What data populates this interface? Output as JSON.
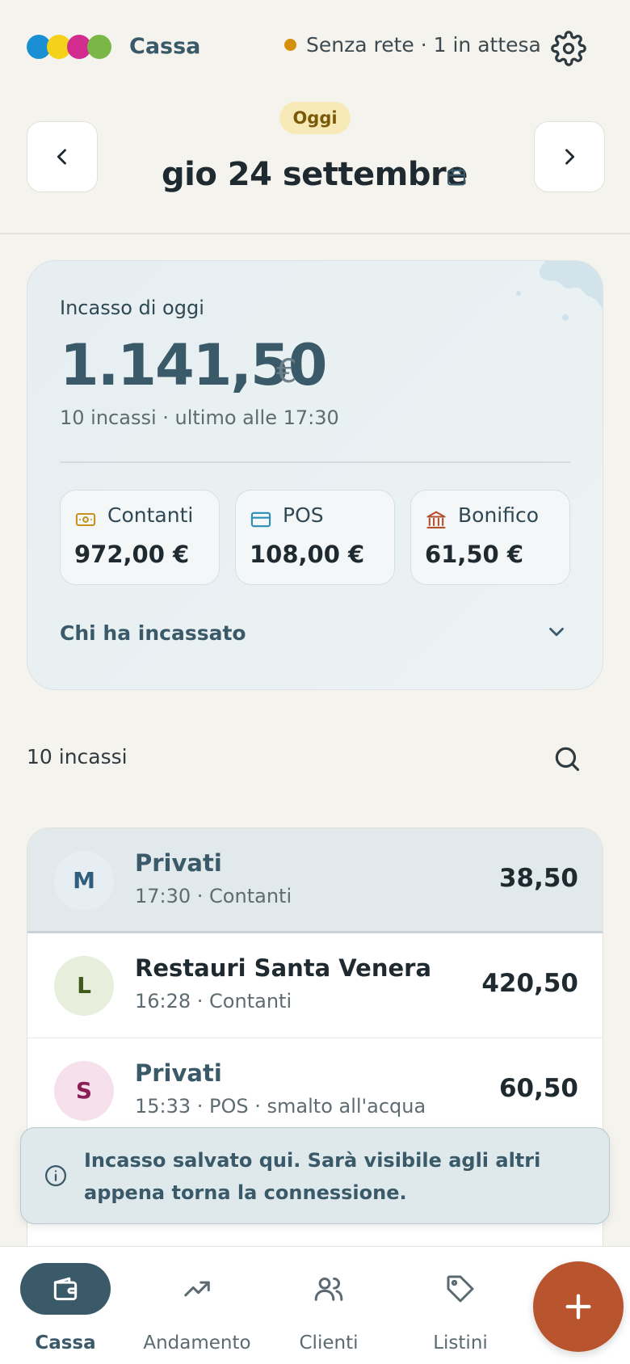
{
  "header": {
    "app_name": "Cassa",
    "logo_colors": [
      "#1b8fd4",
      "#f4d21a",
      "#d12c8e",
      "#7bb746"
    ],
    "status_text": "Senza rete · 1 in attesa",
    "status_color": "#d4900a",
    "settings_icon": "gear-icon"
  },
  "date_nav": {
    "today_badge": "Oggi",
    "date_label": "gio 24 settembre",
    "prev_icon": "chevron-left-icon",
    "next_icon": "chevron-right-icon",
    "calendar_icon": "calendar-icon"
  },
  "summary": {
    "label": "Incasso di oggi",
    "total": "1.141,50",
    "currency": "€",
    "subtitle": "10 incassi · ultimo alle 17:30",
    "methods": [
      {
        "label": "Contanti",
        "value": "972,00 €",
        "icon": "cash-icon",
        "color": "#c7921f"
      },
      {
        "label": "POS",
        "value": "108,00 €",
        "icon": "card-icon",
        "color": "#2a8db6"
      },
      {
        "label": "Bonifico",
        "value": "61,50 €",
        "icon": "bank-icon",
        "color": "#b4502d"
      }
    ],
    "who_label": "Chi ha incassato"
  },
  "list": {
    "count_label": "10 incassi",
    "items": [
      {
        "initial": "M",
        "name": "Privati",
        "meta": "17:30 · Contanti",
        "amount": "38,50",
        "avatar_bg": "#e7eef3",
        "avatar_fg": "#2f5e7c",
        "name_color": "#3a5a69"
      },
      {
        "initial": "L",
        "name": "Restauri Santa Venera",
        "meta": "16:28 · Contanti",
        "amount": "420,50",
        "avatar_bg": "#e8eedc",
        "avatar_fg": "#3f5a1a",
        "name_color": "#1f2a30"
      },
      {
        "initial": "S",
        "name": "Privati",
        "meta": "15:33 · POS · smalto all'acqua",
        "amount": "60,50",
        "avatar_bg": "#f6e0ec",
        "avatar_fg": "#8a1f57",
        "name_color": "#3a5a69"
      }
    ]
  },
  "toast": {
    "text": "Incasso salvato qui. Sarà visibile agli altri appena torna la connessione.",
    "icon": "info-icon"
  },
  "bottom_nav": {
    "tabs": [
      {
        "label": "Cassa",
        "icon": "wallet-icon",
        "active": true
      },
      {
        "label": "Andamento",
        "icon": "trend-icon",
        "active": false
      },
      {
        "label": "Clienti",
        "icon": "users-icon",
        "active": false
      },
      {
        "label": "Listini",
        "icon": "tag-icon",
        "active": false
      }
    ],
    "fab_icon": "plus-icon",
    "fab_color": "#b9552e"
  }
}
